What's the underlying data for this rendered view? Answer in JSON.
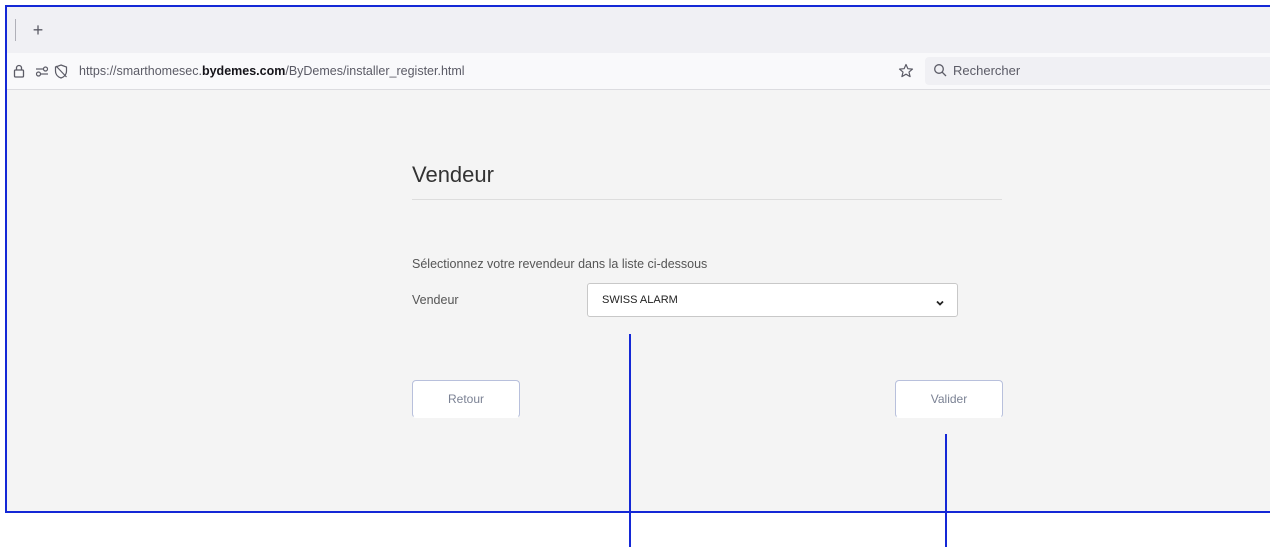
{
  "browser": {
    "new_tab_label": "+",
    "url_prefix": "https://smarthomesec.",
    "url_domain": "bydemes.com",
    "url_path": "/ByDemes/installer_register.html",
    "search_placeholder": "Rechercher"
  },
  "page": {
    "title": "Vendeur",
    "instruction": "Sélectionnez votre revendeur dans la liste ci-dessous",
    "field_label": "Vendeur",
    "selected_vendor": "SWISS ALARM",
    "back_label": "Retour",
    "submit_label": "Valider"
  },
  "icons": {
    "lock": "lock-icon",
    "permissions": "permissions-icon",
    "tracking_protection": "tracking-protection-icon",
    "bookmark": "star-icon",
    "search": "search-icon",
    "dropdown": "chevron-down-icon"
  },
  "colors": {
    "annotation": "#1428d6",
    "page_background": "#f4f4f4",
    "button_border": "#b8c0dc"
  }
}
